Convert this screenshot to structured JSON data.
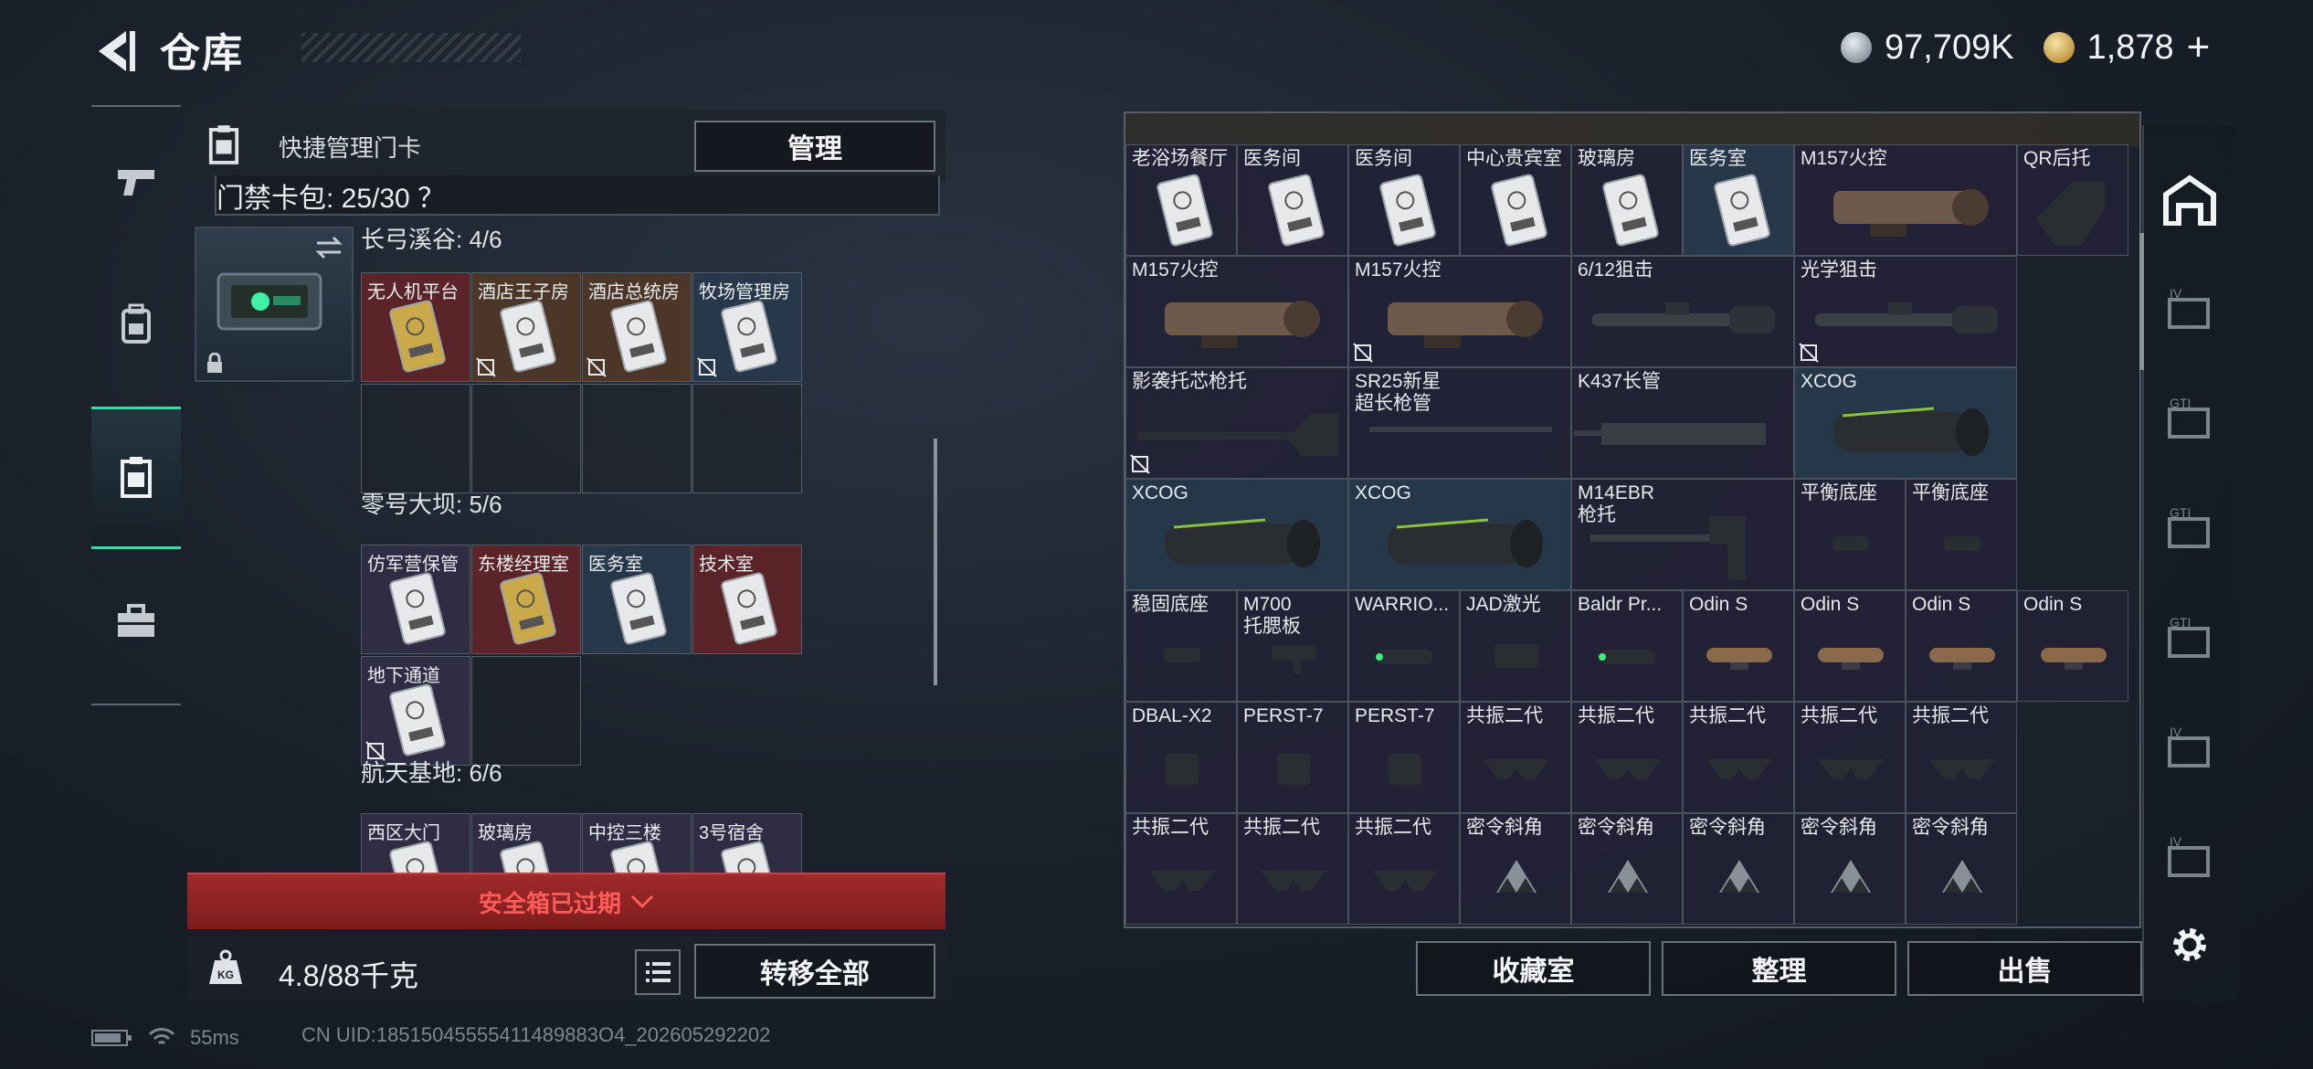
{
  "header": {
    "title": "仓库",
    "silver_amount": "97,709K",
    "gold_amount": "1,878",
    "gold_plus": "+"
  },
  "left_nav": {
    "items": [
      {
        "name": "weapons",
        "icon": "pistol-icon"
      },
      {
        "name": "equipment",
        "icon": "backpack-icon"
      },
      {
        "name": "keycards",
        "icon": "keycard-holder-icon",
        "active": true
      },
      {
        "name": "items",
        "icon": "toolbox-icon"
      }
    ]
  },
  "keycard_panel": {
    "quick_manage_label": "快捷管理门卡",
    "manage_button": "管理",
    "pack_label": "门禁卡包: 25/30 ？",
    "sections": [
      {
        "title": "长弓溪谷: 4/6",
        "cards": [
          {
            "label": "无人机平台",
            "color": "red",
            "card": "gold"
          },
          {
            "label": "酒店王子房",
            "color": "brown",
            "card": "white",
            "locked": true
          },
          {
            "label": "酒店总统房",
            "color": "brown",
            "card": "white",
            "locked": true
          },
          {
            "label": "牧场管理房",
            "color": "blue",
            "card": "white",
            "locked": true
          }
        ]
      },
      {
        "title": "零号大坝: 5/6",
        "cards": [
          {
            "label": "仿军营保管",
            "color": "purple",
            "card": "white"
          },
          {
            "label": "东楼经理室",
            "color": "red",
            "card": "gold"
          },
          {
            "label": "医务室",
            "color": "blue",
            "card": "white"
          },
          {
            "label": "技术室",
            "color": "red",
            "card": "white"
          },
          {
            "label": "地下通道",
            "color": "purple",
            "card": "white",
            "locked": true
          }
        ]
      },
      {
        "title": "航天基地: 6/6",
        "cards": [
          {
            "label": "西区大门",
            "color": "purple",
            "card": "white"
          },
          {
            "label": "玻璃房",
            "color": "purple",
            "card": "white"
          },
          {
            "label": "中控三楼",
            "color": "purple",
            "card": "white"
          },
          {
            "label": "3号宿舍",
            "color": "purple",
            "card": "white"
          }
        ]
      }
    ],
    "expired_text": "安全箱已过期",
    "weight": "4.8/88千克",
    "transfer_all": "转移全部"
  },
  "storage_grid": {
    "rows": [
      [
        {
          "label": "老浴场餐厅",
          "icon": "keycard"
        },
        {
          "label": "医务间",
          "icon": "keycard"
        },
        {
          "label": "医务间",
          "icon": "keycard"
        },
        {
          "label": "中心贵宾室",
          "icon": "keycard"
        },
        {
          "label": "玻璃房",
          "icon": "keycard"
        },
        {
          "label": "医务室",
          "icon": "keycard"
        },
        {
          "label": "M157火控",
          "icon": "firecontrol",
          "span": 2
        },
        {
          "label": "QR后托",
          "icon": "stock-tall"
        }
      ],
      [
        {
          "label": "M157火控",
          "icon": "firecontrol",
          "span": 2
        },
        {
          "label": "M157火控",
          "icon": "firecontrol",
          "span": 2,
          "locked": true
        },
        {
          "label": "6/12狙击",
          "icon": "scope-long",
          "span": 2
        },
        {
          "label": "光学狙击",
          "icon": "scope-long",
          "span": 2,
          "locked": true
        }
      ],
      [
        {
          "label": "影袭托芯枪托",
          "icon": "stock-long",
          "span": 2,
          "locked": true
        },
        {
          "label": "SR25新星\n超长枪管",
          "icon": "barrel",
          "span": 2
        },
        {
          "label": "K437长管",
          "icon": "handguard",
          "span": 2
        },
        {
          "label": "XCOG",
          "icon": "xcog",
          "span": 2
        }
      ],
      [
        {
          "label": "XCOG",
          "icon": "xcog",
          "span": 2
        },
        {
          "label": "XCOG",
          "icon": "xcog",
          "span": 2
        },
        {
          "label": "M14EBR\n枪托",
          "icon": "stock-folding",
          "span": 2
        },
        {
          "label": "平衡底座",
          "icon": "mount"
        },
        {
          "label": "平衡底座",
          "icon": "mount"
        }
      ],
      [
        {
          "label": "稳固底座",
          "icon": "mount"
        },
        {
          "label": "M700\n托腮板",
          "icon": "cheekpad"
        },
        {
          "label": "WARRIO...",
          "icon": "flashlight"
        },
        {
          "label": "JAD激光",
          "icon": "laser"
        },
        {
          "label": "Baldr Pr...",
          "icon": "flashlight"
        },
        {
          "label": "Odin S",
          "icon": "odin"
        },
        {
          "label": "Odin S",
          "icon": "odin"
        },
        {
          "label": "Odin S",
          "icon": "odin"
        },
        {
          "label": "Odin S",
          "icon": "odin"
        }
      ],
      [
        {
          "label": "DBAL-X2",
          "icon": "dbal"
        },
        {
          "label": "PERST-7",
          "icon": "dbal"
        },
        {
          "label": "PERST-7",
          "icon": "dbal"
        },
        {
          "label": "共振二代",
          "icon": "grip"
        },
        {
          "label": "共振二代",
          "icon": "grip"
        },
        {
          "label": "共振二代",
          "icon": "grip"
        },
        {
          "label": "共振二代",
          "icon": "grip"
        },
        {
          "label": "共振二代",
          "icon": "grip"
        }
      ],
      [
        {
          "label": "共振二代",
          "icon": "grip"
        },
        {
          "label": "共振二代",
          "icon": "grip"
        },
        {
          "label": "共振二代",
          "icon": "grip"
        },
        {
          "label": "密令斜角",
          "icon": "triangles"
        },
        {
          "label": "密令斜角",
          "icon": "triangles"
        },
        {
          "label": "密令斜角",
          "icon": "triangles"
        },
        {
          "label": "密令斜角",
          "icon": "triangles"
        },
        {
          "label": "密令斜角",
          "icon": "triangles"
        }
      ]
    ],
    "actions": [
      "收藏室",
      "整理",
      "出售"
    ]
  },
  "status_bar": {
    "ping": "55ms",
    "uid": "CN UID:18515045555411489883О4_202605292202"
  }
}
